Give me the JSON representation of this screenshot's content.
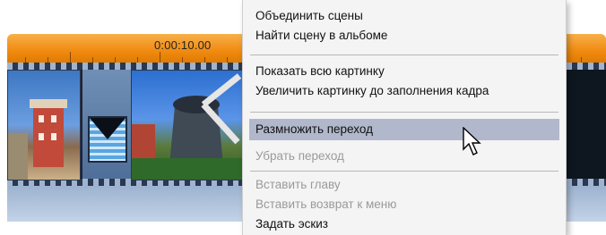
{
  "timeline": {
    "timecode": "0:00:10.00"
  },
  "menu": {
    "items": [
      {
        "label": "Объединить сцены",
        "enabled": true
      },
      {
        "label": "Найти сцену в альбоме",
        "enabled": true
      },
      {
        "label": "Показать всю картинку",
        "enabled": true
      },
      {
        "label": "Увеличить картинку до заполнения кадра",
        "enabled": true
      },
      {
        "label": "Размножить переход",
        "enabled": true,
        "highlighted": true
      },
      {
        "label": "Убрать переход",
        "enabled": false
      },
      {
        "label": "Вставить главу",
        "enabled": false
      },
      {
        "label": "Вставить возврат к меню",
        "enabled": false
      },
      {
        "label": "Задать эскиз",
        "enabled": true
      }
    ]
  },
  "colors": {
    "ruler_orange": "#f08a10",
    "menu_bg": "#f4f4f4",
    "highlight": "#b2b8cc",
    "disabled_text": "#9a9a9a"
  },
  "icons": {
    "transition": "transition-hourglass-icon",
    "cursor": "mouse-pointer-icon"
  }
}
